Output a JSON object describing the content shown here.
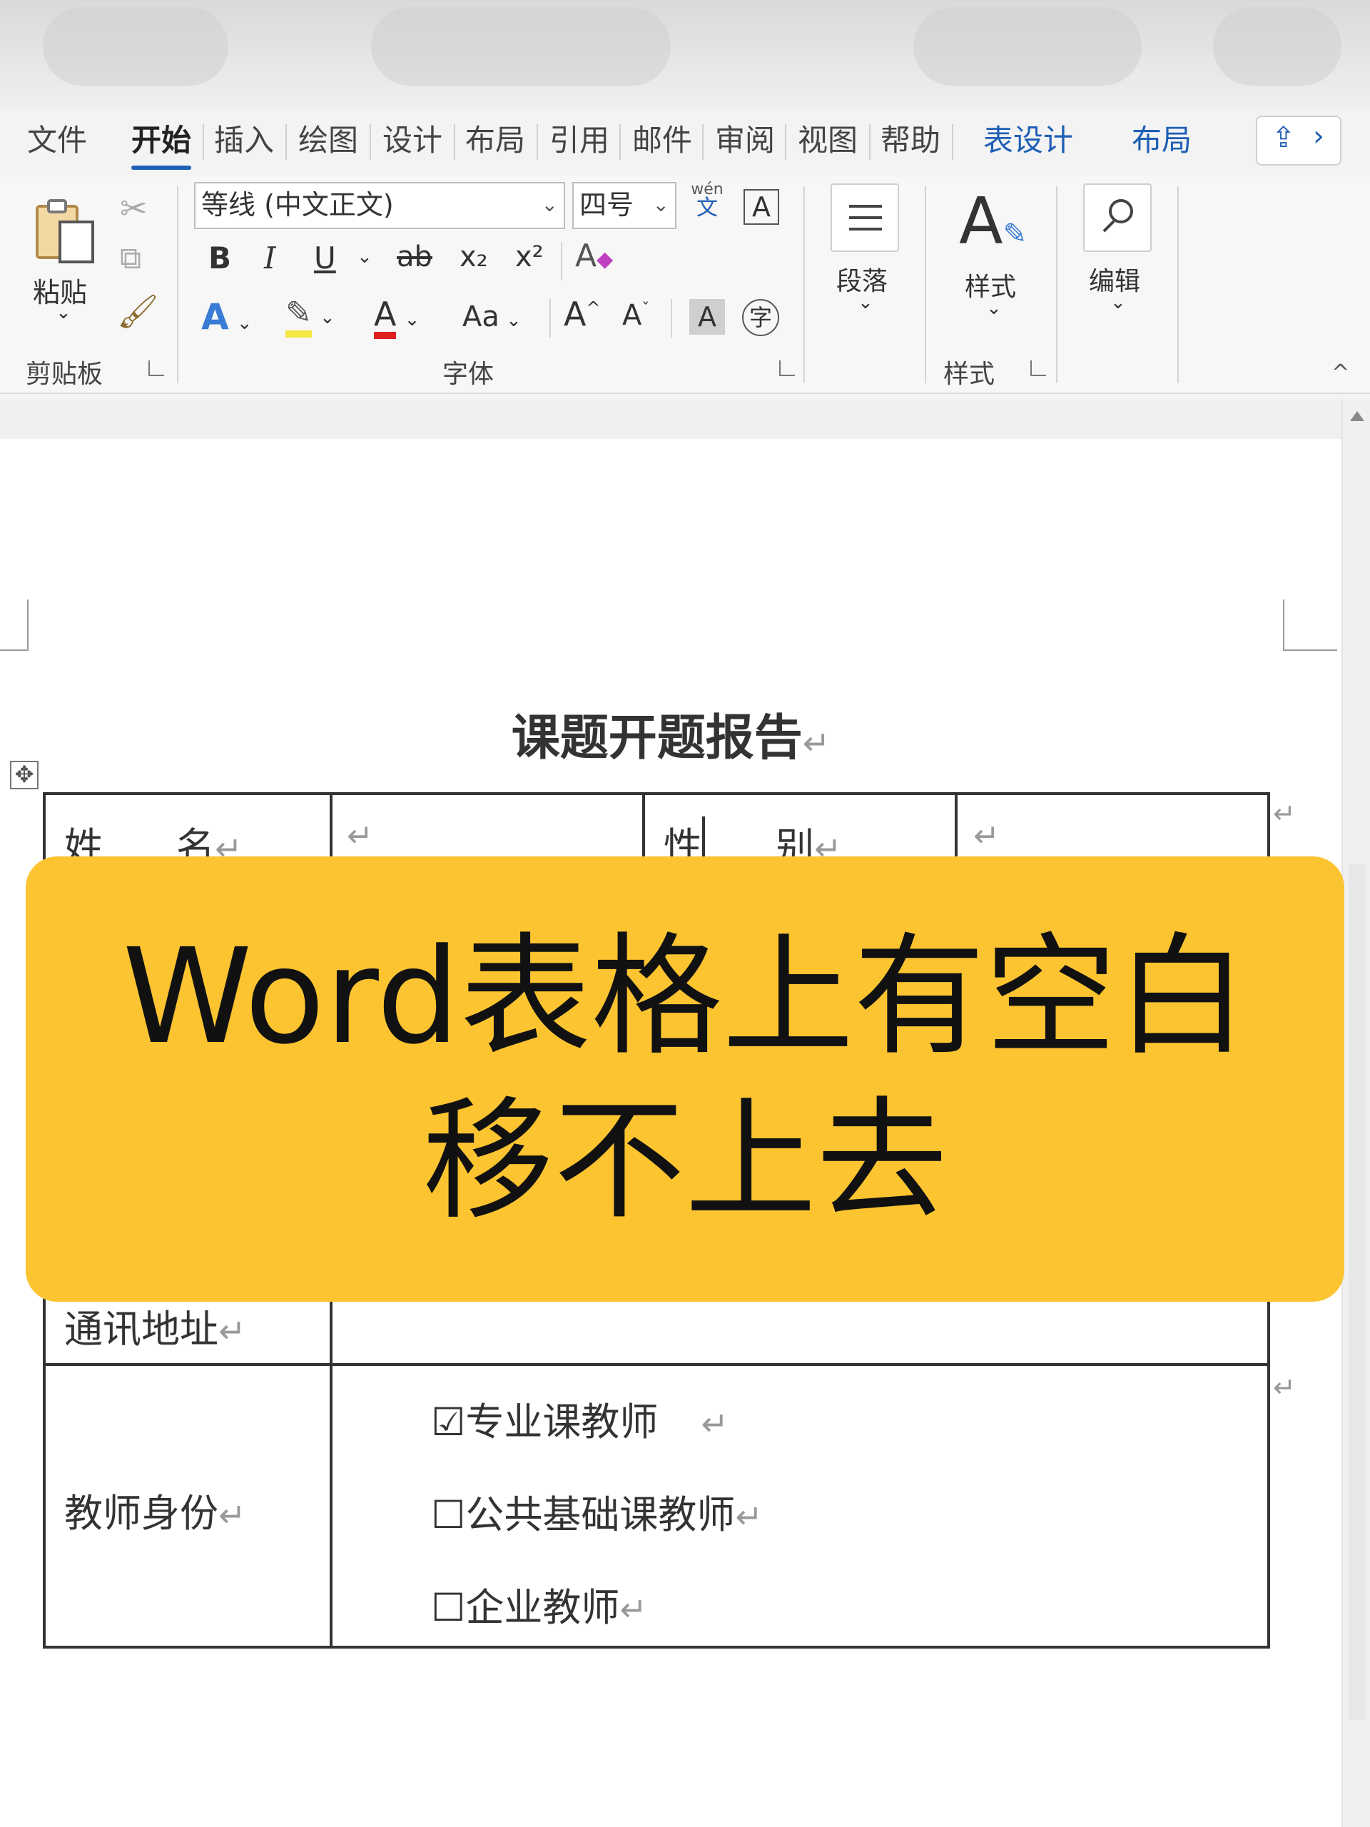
{
  "tabs": [
    "文件",
    "开始",
    "插入",
    "绘图",
    "设计",
    "布局",
    "引用",
    "邮件",
    "审阅",
    "视图",
    "帮助",
    "表设计",
    "布局"
  ],
  "ribbon": {
    "paste_label": "粘贴",
    "clipboard_group": "剪贴板",
    "font_name": "等线 (中文正文)",
    "font_size": "四号",
    "bold": "B",
    "italic": "I",
    "underline": "U",
    "strikethrough": "ab",
    "subscript": "x₂",
    "superscript": "x²",
    "font_group": "字体",
    "paragraph_label": "段落",
    "styles_label": "样式",
    "styles_group": "样式",
    "edit_label": "编辑",
    "case_label": "Aa",
    "pinyin": "wén",
    "pinyin_char": "文",
    "char_border": "A",
    "char_shade": "A",
    "enclose": "字",
    "grow": "A",
    "shrink": "A",
    "font_color": "A",
    "text_effects": "A"
  },
  "document": {
    "title": "课题开题报告",
    "paragraph_mark": "↵",
    "row1": {
      "name_label": "姓      名",
      "gender_label": "性      别"
    },
    "address_label": "通讯地址",
    "identity_label": "教师身份",
    "options": [
      {
        "checked": true,
        "box": "☑",
        "label": "专业课教师"
      },
      {
        "checked": false,
        "box": "☐",
        "label": "公共基础课教师"
      },
      {
        "checked": false,
        "box": "☐",
        "label": "企业教师"
      }
    ]
  },
  "banner": {
    "line1": "Word表格上有空白",
    "line2": "移不上去",
    "color": "#fcc430"
  },
  "colors": {
    "accent": "#1f5fb5",
    "highlight": "#f5e642",
    "font_red": "#e02020"
  }
}
